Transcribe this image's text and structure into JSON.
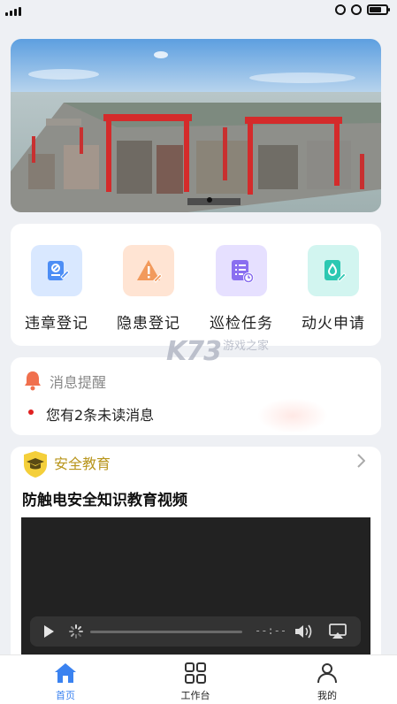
{
  "status_bar": {
    "icons": [
      "signal-icon",
      "rotation-lock-icon",
      "alarm-icon",
      "battery-icon"
    ]
  },
  "quick_actions": [
    {
      "label": "违章登记",
      "icon": "violation-report-icon",
      "color": "#4d8ef5",
      "bg": "#d9e8ff"
    },
    {
      "label": "隐患登记",
      "icon": "hazard-warning-icon",
      "color": "#f29a5c",
      "bg": "#ffe4d3"
    },
    {
      "label": "巡检任务",
      "icon": "inspection-checklist-icon",
      "color": "#8a6ff0",
      "bg": "#e6e0ff"
    },
    {
      "label": "动火申请",
      "icon": "hot-work-fire-icon",
      "color": "#2cc8b2",
      "bg": "#d2f5f0"
    }
  ],
  "messages": {
    "title": "消息提醒",
    "text": "您有2条未读消息"
  },
  "education": {
    "title": "安全教育",
    "video_title": "防触电安全知识教育视频",
    "time": "--:--"
  },
  "tabbar": {
    "tabs": [
      {
        "label": "首页",
        "icon": "home-icon",
        "active": true
      },
      {
        "label": "工作台",
        "icon": "grid-icon",
        "active": false
      },
      {
        "label": "我的",
        "icon": "user-icon",
        "active": false
      }
    ],
    "active_color": "#3a82f0"
  },
  "watermark": {
    "logo": "K73",
    "sub": "游戏之家"
  }
}
